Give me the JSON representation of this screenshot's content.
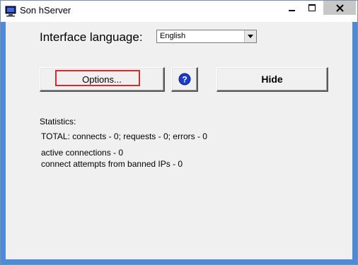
{
  "window": {
    "title": "Son hServer",
    "icon": "monitor-app-icon",
    "controls": [
      "minimize-icon",
      "maximize-icon",
      "close-icon"
    ]
  },
  "language": {
    "label": "Interface language:",
    "selected": "English"
  },
  "buttons": {
    "options": "Options...",
    "help_icon": "question-icon",
    "hide": "Hide"
  },
  "statistics": {
    "heading": "Statistics:",
    "total": "TOTAL: connects - 0; requests - 0; errors - 0",
    "active": "active connections - 0",
    "banned": "connect attempts from banned IPs - 0"
  },
  "colors": {
    "focus_rect": "#e0262a",
    "help_icon_bg": "#1c3cc8",
    "window_border": "#4d8bd8"
  }
}
